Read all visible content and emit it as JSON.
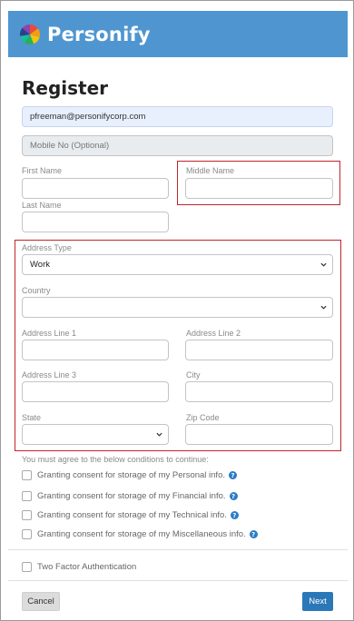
{
  "app": {
    "brand": "Personify"
  },
  "page": {
    "title": "Register"
  },
  "form": {
    "email": {
      "value": "pfreeman@personifycorp.com"
    },
    "mobile": {
      "placeholder": "Mobile No (Optional)"
    },
    "first_name": {
      "label": "First Name",
      "value": ""
    },
    "middle_name": {
      "label": "Middle Name",
      "value": ""
    },
    "last_name": {
      "label": "Last Name",
      "value": ""
    },
    "address_type": {
      "label": "Address Type",
      "value": "Work"
    },
    "country": {
      "label": "Country",
      "value": ""
    },
    "address_line_1": {
      "label": "Address Line 1",
      "value": ""
    },
    "address_line_2": {
      "label": "Address Line 2",
      "value": ""
    },
    "address_line_3": {
      "label": "Address Line 3",
      "value": ""
    },
    "city": {
      "label": "City",
      "value": ""
    },
    "state": {
      "label": "State",
      "value": ""
    },
    "zip": {
      "label": "Zip Code",
      "value": ""
    }
  },
  "conditions": {
    "intro": "You must agree to the below conditions to continue:",
    "items": [
      {
        "label": "Granting consent for storage of my Personal info.",
        "checked": false
      },
      {
        "label": "Granting consent for storage of my Financial info.",
        "checked": false
      },
      {
        "label": "Granting consent for storage of my Technical info.",
        "checked": false
      },
      {
        "label": "Granting consent for storage of my Miscellaneous info.",
        "checked": false
      }
    ]
  },
  "two_factor": {
    "label": "Two Factor Authentication",
    "checked": false
  },
  "buttons": {
    "cancel": "Cancel",
    "next": "Next"
  },
  "colors": {
    "header": "#4f96d0",
    "highlight": "#c0242c",
    "next_button": "#2b78b8",
    "help_icon": "#2a7bc8"
  },
  "icons": [
    "personify-logo-icon",
    "chevron-down-icon",
    "help-icon"
  ]
}
